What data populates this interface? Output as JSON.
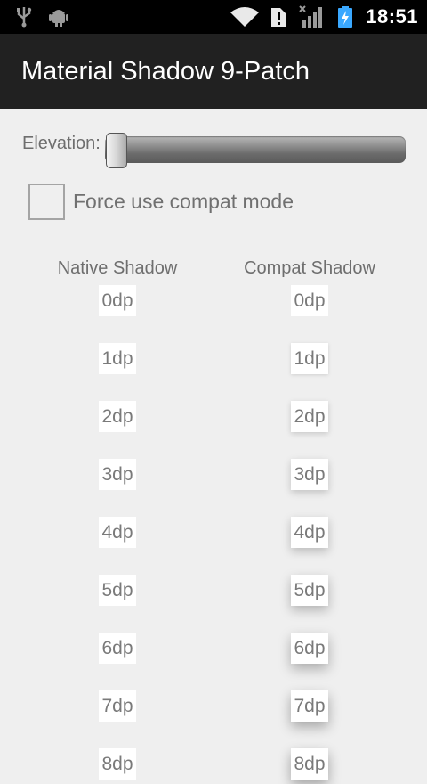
{
  "status_bar": {
    "time": "18:51",
    "icons": [
      "usb-icon",
      "android-debug-icon",
      "wifi-icon",
      "alert-icon",
      "signal-icon",
      "battery-charging-icon"
    ]
  },
  "action_bar": {
    "title": "Material Shadow 9-Patch"
  },
  "elevation": {
    "label": "Elevation:",
    "value": 0
  },
  "compat_checkbox": {
    "label": "Force use compat mode",
    "checked": false
  },
  "columns": {
    "native_header": "Native Shadow",
    "compat_header": "Compat Shadow"
  },
  "native_cards": [
    "0dp",
    "1dp",
    "2dp",
    "3dp",
    "4dp",
    "5dp",
    "6dp",
    "7dp",
    "8dp"
  ],
  "compat_cards": [
    "0dp",
    "1dp",
    "2dp",
    "3dp",
    "4dp",
    "5dp",
    "6dp",
    "7dp",
    "8dp"
  ],
  "colors": {
    "status_bar": "#000000",
    "action_bar": "#212121",
    "background": "#efefef",
    "card": "#ffffff",
    "text_gray": "#6e6e6e",
    "battery_accent": "#3aa8ff"
  }
}
